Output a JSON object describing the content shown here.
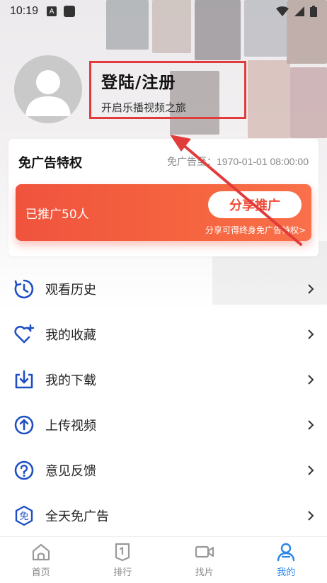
{
  "status_bar": {
    "time": "10:19",
    "notif_a": "A"
  },
  "profile": {
    "login_title": "登陆/注册",
    "login_subtitle": "开启乐播视频之旅"
  },
  "ad_free": {
    "title": "免广告特权",
    "expire": "免广告至：1970-01-01 08:00:00",
    "promoted_count": "已推广50人",
    "share_button": "分享推广",
    "share_note": "分享可得终身免广告特权>"
  },
  "menu": {
    "items": [
      {
        "label": "观看历史",
        "icon": "history-icon"
      },
      {
        "label": "我的收藏",
        "icon": "favorite-heart-icon"
      },
      {
        "label": "我的下载",
        "icon": "download-icon"
      },
      {
        "label": "上传视频",
        "icon": "upload-icon"
      },
      {
        "label": "意见反馈",
        "icon": "feedback-question-icon"
      },
      {
        "label": "全天免广告",
        "icon": "ad-free-badge-icon"
      }
    ]
  },
  "bottom_nav": {
    "items": [
      {
        "label": "首页",
        "icon": "home-icon"
      },
      {
        "label": "排行",
        "icon": "ranking-icon"
      },
      {
        "label": "找片",
        "icon": "video-camera-icon"
      },
      {
        "label": "我的",
        "icon": "user-icon"
      }
    ],
    "active": "我的"
  },
  "colors": {
    "accent_red": "#f0533d",
    "icon_blue": "#1f4fc4",
    "nav_active": "#2b87e8",
    "annotation_red": "#e23b3b"
  }
}
